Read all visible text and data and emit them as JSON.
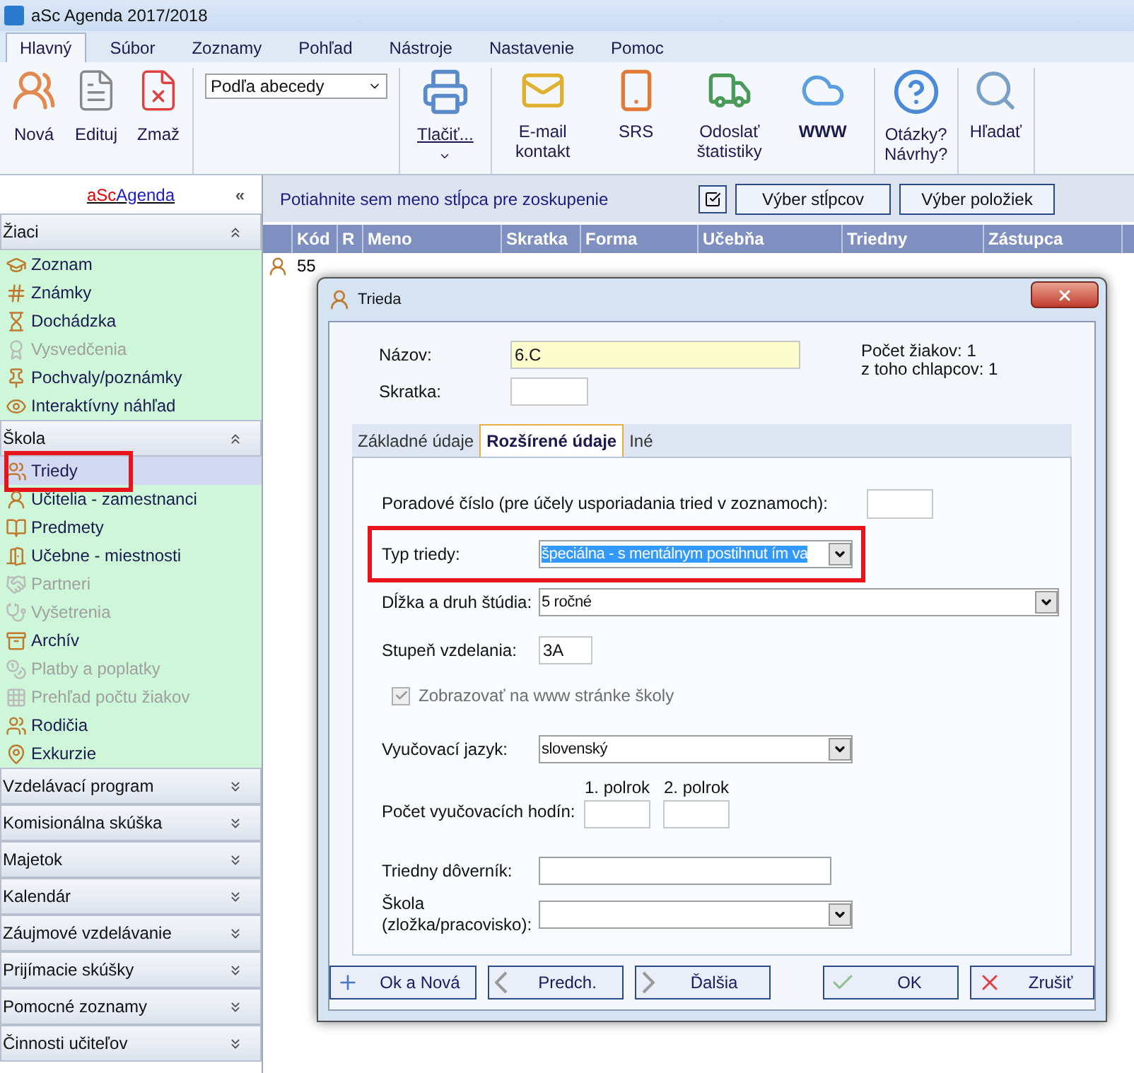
{
  "window": {
    "title": "aSc Agenda 2017/2018"
  },
  "menu_tabs": [
    {
      "label": "Hlavný",
      "selected": true
    },
    {
      "label": "Súbor",
      "selected": false
    },
    {
      "label": "Zoznamy",
      "selected": false
    },
    {
      "label": "Pohľad",
      "selected": false
    },
    {
      "label": "Nástroje",
      "selected": false
    },
    {
      "label": "Nastavenie",
      "selected": false
    },
    {
      "label": "Pomoc",
      "selected": false
    }
  ],
  "ribbon": {
    "record_buttons": [
      "Nová",
      "Edituj",
      "Zmaž"
    ],
    "sort_combo": {
      "value": "Podľa abecedy"
    },
    "print_button": "Tlačiť...",
    "share_buttons": [
      {
        "kind": "mail",
        "label": "E-mail kontakt"
      },
      {
        "kind": "phone",
        "label": "SRS"
      },
      {
        "kind": "truck",
        "label": "Odoslať štatistiky"
      },
      {
        "kind": "cloud",
        "label": "WWW"
      }
    ],
    "help_button": "Otázky? Návrhy?",
    "search_button": "Hľadať"
  },
  "sidebar": {
    "logo": {
      "part_1": "aSc",
      "part_2": "Agenda"
    },
    "collapse_glyph": "«",
    "sections": [
      {
        "title": "Žiaci",
        "expanded": true,
        "items": [
          {
            "label": "Zoznam",
            "disabled": false,
            "selected": false,
            "highlighted": false
          },
          {
            "label": "Známky",
            "disabled": false,
            "selected": false,
            "highlighted": false
          },
          {
            "label": "Dochádzka",
            "disabled": false,
            "selected": false,
            "highlighted": false
          },
          {
            "label": "Vysvedčenia",
            "disabled": true,
            "selected": false,
            "highlighted": false
          },
          {
            "label": "Pochvaly/poznámky",
            "disabled": false,
            "selected": false,
            "highlighted": false
          },
          {
            "label": "Interaktívny náhľad",
            "disabled": false,
            "selected": false,
            "highlighted": false
          }
        ]
      },
      {
        "title": "Škola",
        "expanded": true,
        "items": [
          {
            "label": "Triedy",
            "disabled": false,
            "selected": true,
            "highlighted": true
          },
          {
            "label": "Učitelia - zamestnanci",
            "disabled": false,
            "selected": false,
            "highlighted": false
          },
          {
            "label": "Predmety",
            "disabled": false,
            "selected": false,
            "highlighted": false
          },
          {
            "label": "Učebne - miestnosti",
            "disabled": false,
            "selected": false,
            "highlighted": false
          },
          {
            "label": "Partneri",
            "disabled": true,
            "selected": false,
            "highlighted": false
          },
          {
            "label": "Vyšetrenia",
            "disabled": true,
            "selected": false,
            "highlighted": false
          },
          {
            "label": "Archív",
            "disabled": false,
            "selected": false,
            "highlighted": false
          },
          {
            "label": "Platby a poplatky",
            "disabled": true,
            "selected": false,
            "highlighted": false
          },
          {
            "label": "Prehľad počtu žiakov",
            "disabled": true,
            "selected": false,
            "highlighted": false
          },
          {
            "label": "Rodičia",
            "disabled": false,
            "selected": false,
            "highlighted": false
          },
          {
            "label": "Exkurzie",
            "disabled": false,
            "selected": false,
            "highlighted": false
          }
        ]
      },
      {
        "title": "Vzdelávací program",
        "expanded": false
      },
      {
        "title": "Komisionálna skúška",
        "expanded": false
      },
      {
        "title": "Majetok",
        "expanded": false
      },
      {
        "title": "Kalendár",
        "expanded": false
      },
      {
        "title": "Záujmové vzdelávanie",
        "expanded": false
      },
      {
        "title": "Prijímacie skúšky",
        "expanded": false
      },
      {
        "title": "Pomocné zoznamy",
        "expanded": false
      },
      {
        "title": "Činnosti učiteľov",
        "expanded": false
      }
    ]
  },
  "grid": {
    "group_hint": "Potiahnite sem meno stĺpca pre zoskupenie",
    "toolbar_buttons": [
      "Výber stĺpcov",
      "Výber položiek"
    ],
    "columns": [
      "Kód",
      "R",
      "Meno",
      "Skratka",
      "Forma",
      "Učebňa",
      "Triedny",
      "Zástupca"
    ],
    "rows": [
      {
        "cells": [
          "55"
        ]
      }
    ]
  },
  "dialog": {
    "title": "Trieda",
    "name_label": "Názov:",
    "name_value": "6.C",
    "short_label": "Skratka:",
    "stats": [
      "Počet žiakov: 1",
      "z toho chlapcov: 1"
    ],
    "tabs": [
      {
        "label": "Základné údaje",
        "selected": false
      },
      {
        "label": "Rozšírené údaje",
        "selected": true
      },
      {
        "label": "Iné",
        "selected": false
      }
    ],
    "fields": [
      {
        "kind": "number",
        "label": "Poradové číslo (pre účely usporiadania tried v zoznamoch):",
        "highlighted": false
      },
      {
        "kind": "select",
        "label": "Typ triedy:",
        "value": "špeciálna - s mentálnym postihnut ím va",
        "highlighted": true
      },
      {
        "kind": "select-wide",
        "label": "Dĺžka a druh štúdia:",
        "value": "5 ročné",
        "highlighted": false
      },
      {
        "kind": "short",
        "label": "Stupeň vzdelania:",
        "value": "3A",
        "highlighted": false
      },
      {
        "kind": "checkbox",
        "label": "Zobrazovať na www stránke školy",
        "checked": true,
        "disabled": true,
        "highlighted": false
      },
      {
        "kind": "select",
        "label": "Vyučovací jazyk:",
        "value": "slovenský",
        "highlighted": false
      },
      {
        "kind": "pair",
        "label": "Počet vyučovacích hodín:",
        "columns": [
          "1. polrok",
          "2. polrok"
        ],
        "highlighted": false
      },
      {
        "kind": "text",
        "label": "Triedny dôverník:",
        "highlighted": false
      },
      {
        "kind": "select",
        "label": "Škola\n(zložka/pracovisko):",
        "highlighted": false
      }
    ],
    "buttons": [
      {
        "kind": "plus",
        "label": "Ok a Nová"
      },
      {
        "kind": "prev",
        "label": "Predch."
      },
      {
        "kind": "next",
        "label": "Ďalšia"
      },
      {
        "kind": "ok",
        "label": "OK"
      },
      {
        "kind": "cancel",
        "label": "Zrušiť"
      }
    ]
  }
}
